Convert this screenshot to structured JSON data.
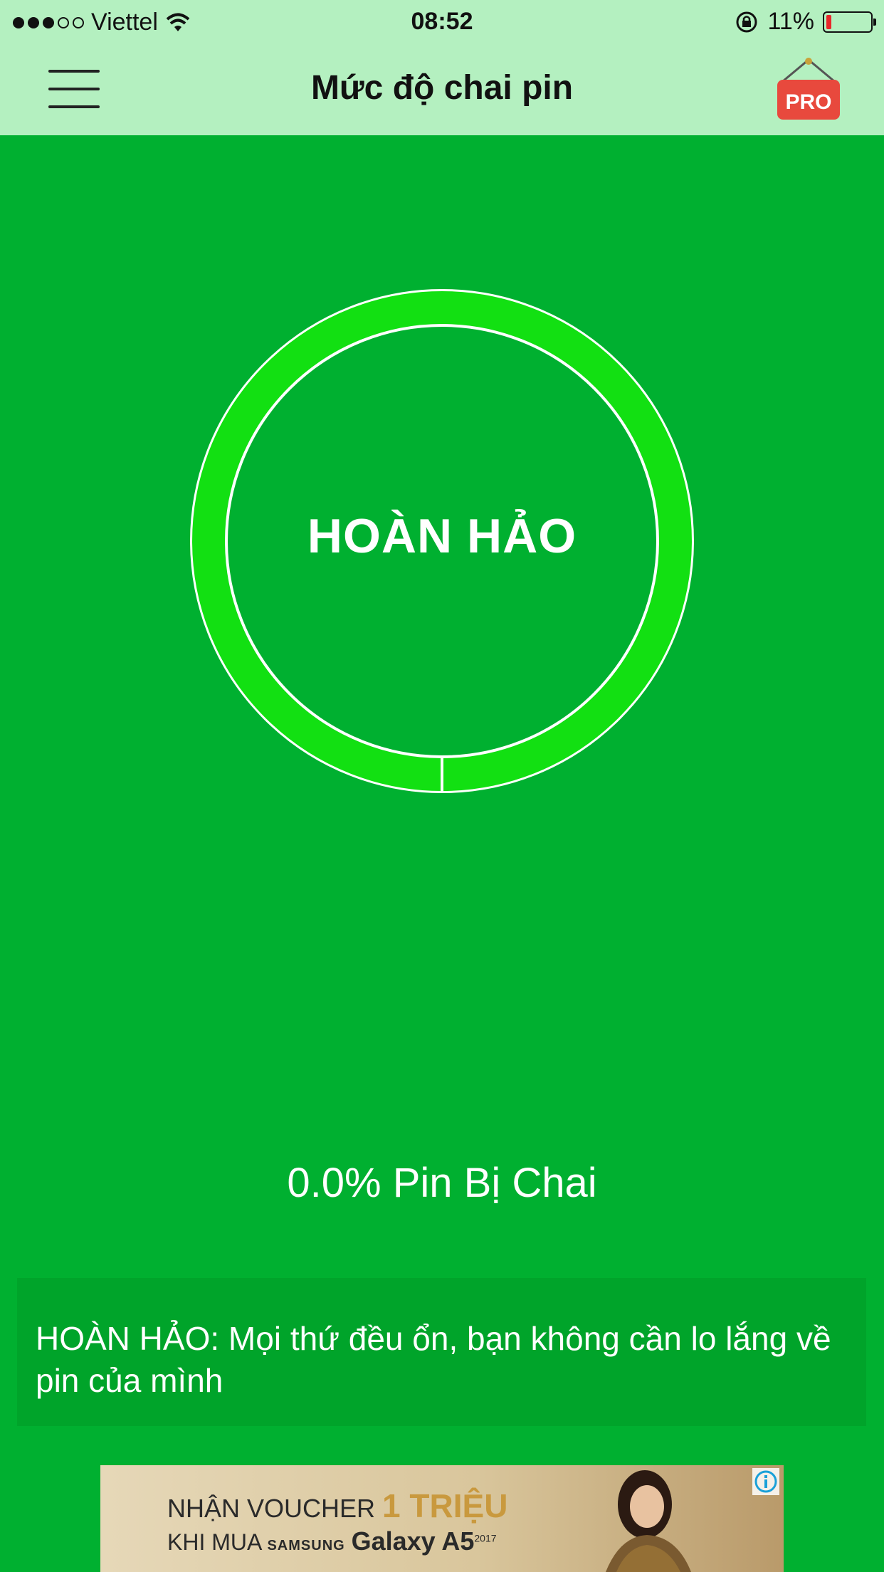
{
  "status_bar": {
    "carrier": "Viettel",
    "time": "08:52",
    "battery_percent": "11%",
    "battery_level": 0.11
  },
  "nav": {
    "title": "Mức độ chai pin",
    "menu_icon": "hamburger-menu-icon",
    "pro_badge": "PRO"
  },
  "gauge": {
    "label": "HOÀN HẢO",
    "wear_fraction": 0.0,
    "ring_color": "#12e012"
  },
  "wear_status": "0.0% Pin Bị Chai",
  "info_text": "HOÀN HẢO: Mọi thứ đều ổn, bạn không cần lo lắng về pin của mình",
  "ad": {
    "line1_prefix": "NHẬN VOUCHER",
    "line1_highlight": "1 TRIỆU",
    "line2_prefix": "KHI MUA",
    "brand": "SAMSUNG",
    "model": "Galaxy A5",
    "model_year": "2017"
  },
  "colors": {
    "background": "#00b030",
    "header": "#b4f0c0",
    "pro_badge": "#e8493d"
  }
}
